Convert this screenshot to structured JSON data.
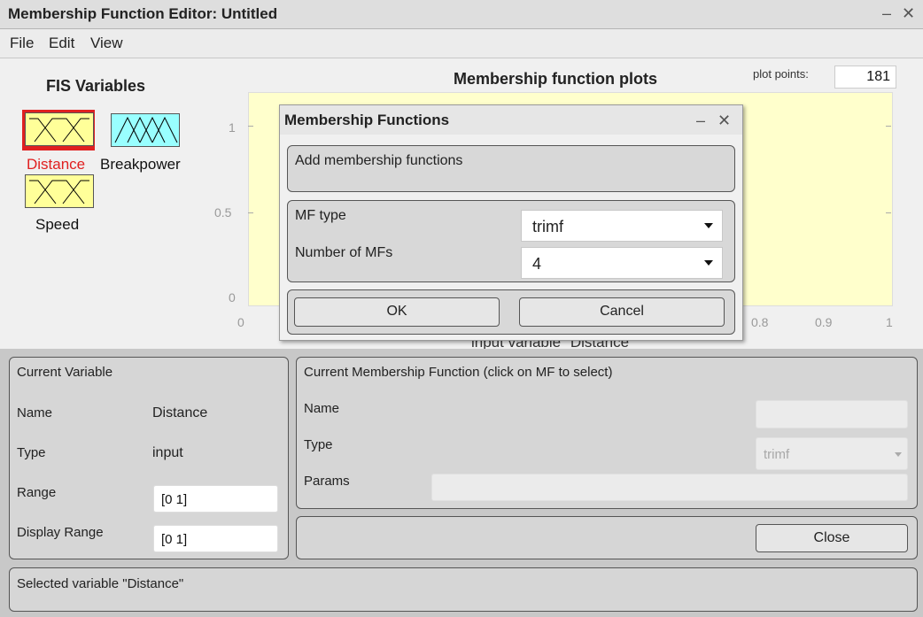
{
  "window": {
    "title": "Membership Function Editor: Untitled",
    "minimize": "–",
    "close": "✕"
  },
  "menu": [
    "File",
    "Edit",
    "View"
  ],
  "fis": {
    "heading": "FIS Variables",
    "variables": [
      {
        "name": "Distance",
        "selected": true,
        "icon": "trapezoid-mf-icon"
      },
      {
        "name": "Breakpower",
        "selected": false,
        "icon": "triangle-mf-icon"
      },
      {
        "name": "Speed",
        "selected": false,
        "icon": "trapezoid-mf-icon"
      }
    ]
  },
  "plot": {
    "title": "Membership function plots",
    "plot_points_label": "plot points:",
    "plot_points_value": "181",
    "y_ticks": [
      "1",
      "0.5",
      "0"
    ],
    "x_ticks": [
      "0",
      "0.8",
      "0.9",
      "1"
    ],
    "x_label": "input variable \"Distance\"",
    "background": "#ffffcc"
  },
  "dialog": {
    "title": "Membership Functions",
    "minimize": "–",
    "close": "✕",
    "add_text": "Add membership functions",
    "mf_type_label": "MF type",
    "mf_type_value": "trimf",
    "num_mfs_label": "Number of MFs",
    "num_mfs_value": "4",
    "ok": "OK",
    "cancel": "Cancel"
  },
  "current_variable": {
    "heading": "Current Variable",
    "name_label": "Name",
    "name_value": "Distance",
    "type_label": "Type",
    "type_value": "input",
    "range_label": "Range",
    "range_value": "[0 1]",
    "display_range_label": "Display Range",
    "display_range_value": "[0 1]"
  },
  "current_mf": {
    "heading": "Current Membership Function (click on MF to select)",
    "name_label": "Name",
    "name_value": "",
    "type_label": "Type",
    "type_value": "trimf",
    "params_label": "Params",
    "params_value": ""
  },
  "close_button": "Close",
  "status": "Selected variable \"Distance\"",
  "colors": {
    "selected_border": "#e02020",
    "selected_label": "#e02020",
    "var_fill_yellow": "#ffff99",
    "var_fill_cyan": "#99ffff",
    "accent_stripe": "#7a3fc0"
  }
}
